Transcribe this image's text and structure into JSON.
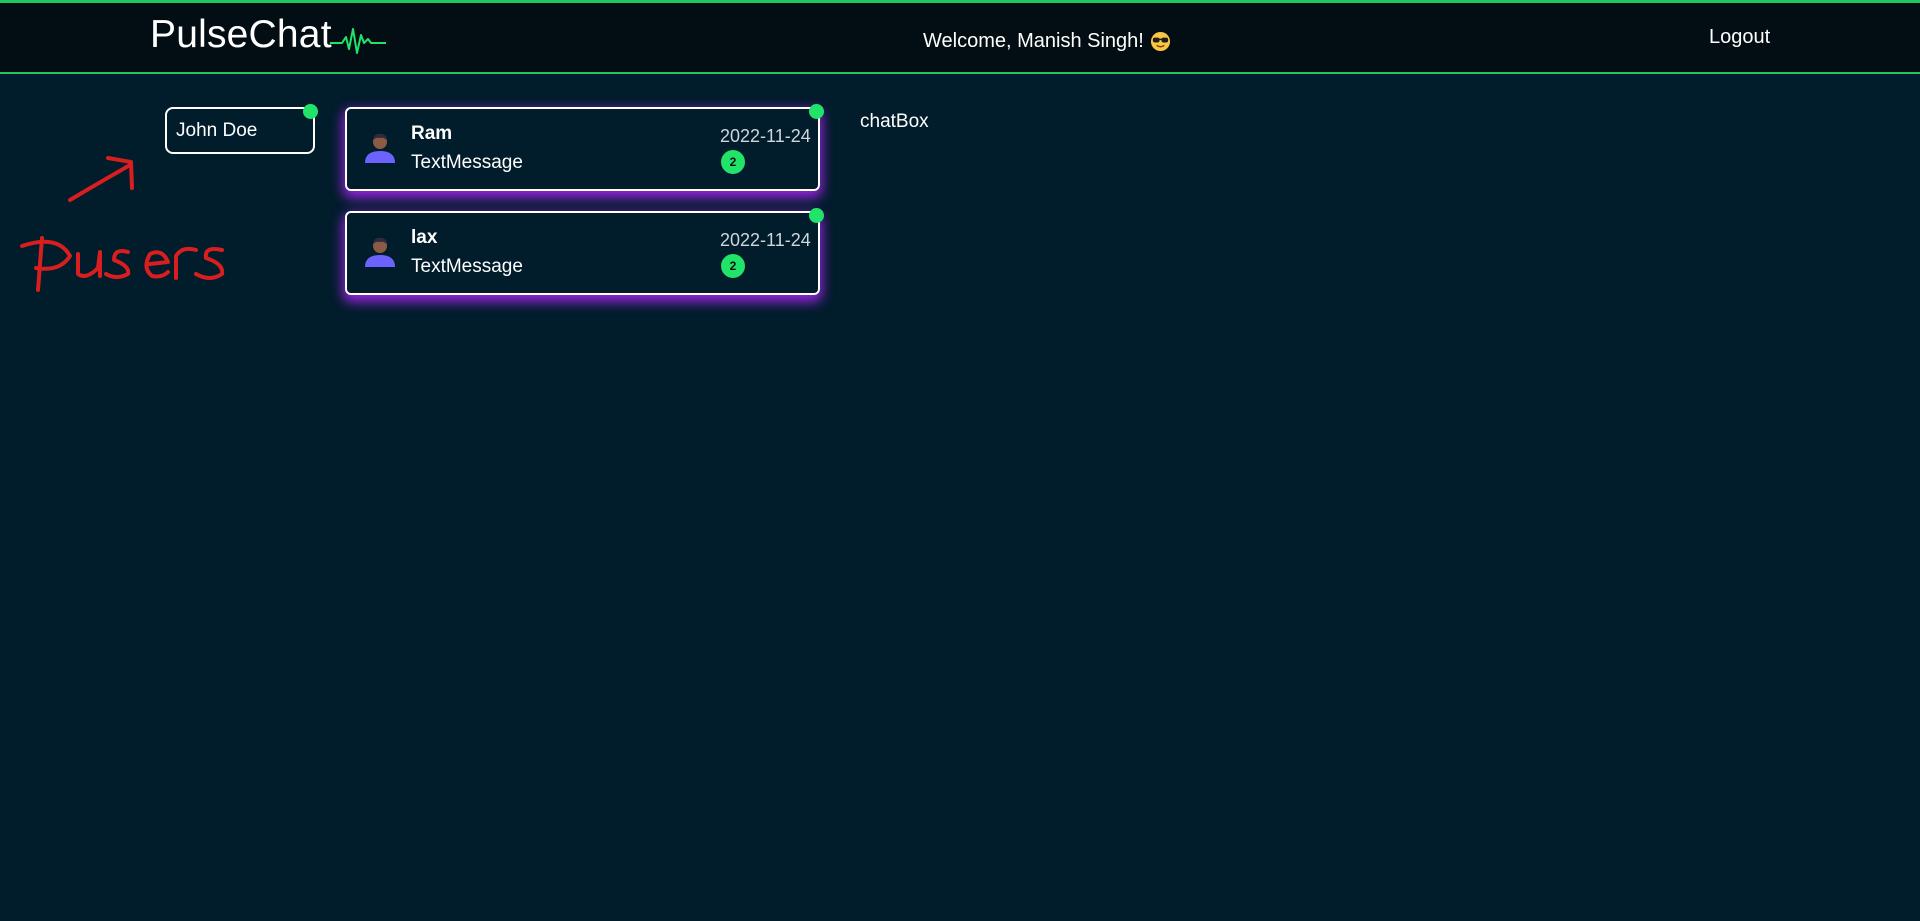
{
  "header": {
    "brand": "PulseChat",
    "welcome": "Welcome, Manish Singh!",
    "logout_label": "Logout"
  },
  "users": [
    {
      "name": "John Doe",
      "online": true
    }
  ],
  "chats": [
    {
      "name": "Ram",
      "last_message": "TextMessage",
      "date": "2022-11-24",
      "unread": "2",
      "online": true
    },
    {
      "name": "lax",
      "last_message": "TextMessage",
      "date": "2022-11-24",
      "unread": "2",
      "online": true
    }
  ],
  "chatbox": {
    "label": "chatBox"
  },
  "annotation": {
    "text": "Pusers"
  },
  "colors": {
    "background": "#011c2b",
    "navbar": "#020e14",
    "accent_green": "#22c55e",
    "online_green": "#22e36a",
    "card_glow": "#b026ff",
    "annotation_red": "#d81e1e"
  },
  "icons": {
    "pulse": "pulse-icon",
    "emoji": "sunglasses-emoji-icon",
    "avatar": "user-avatar-icon",
    "arrow": "arrow-icon"
  }
}
